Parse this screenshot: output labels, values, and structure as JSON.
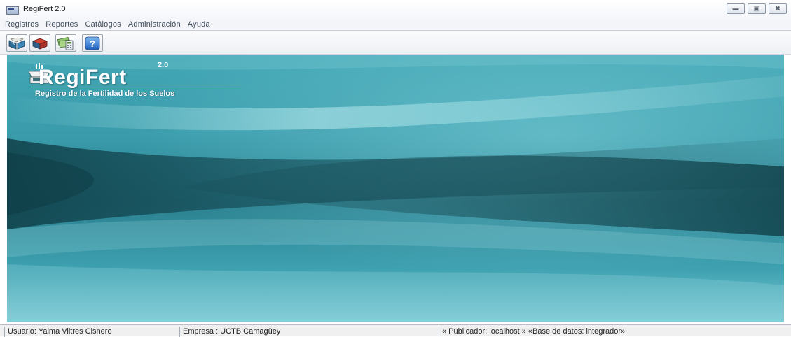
{
  "window": {
    "title": "RegiFert 2.0",
    "controls": [
      "minimize-icon",
      "maximize-icon",
      "close-icon"
    ]
  },
  "menu": {
    "items": [
      {
        "label": "Registros"
      },
      {
        "label": "Reportes"
      },
      {
        "label": "Catálogos"
      },
      {
        "label": "Administración"
      },
      {
        "label": "Ayuda"
      }
    ]
  },
  "toolbar": {
    "buttons": [
      {
        "icon": "open-book-icon"
      },
      {
        "icon": "red-book-icon"
      },
      {
        "icon": "money-calculator-icon"
      },
      {
        "icon": "help-icon"
      }
    ]
  },
  "banner": {
    "app_name": "RegiFert",
    "version": "2.0",
    "subtitle": "Registro de la Fertilidad de los Suelos",
    "logo_icon": "scale-icon"
  },
  "statusbar": {
    "user": "Usuario: Yaima Viltres Cisnero",
    "company": "Empresa : UCTB Camagüey",
    "connection": "« Publicador: localhost » «Base de datos: integrador»"
  },
  "colors": {
    "background_teal": "#3a9cab",
    "dark_teal": "#17505c",
    "help_blue": "#2f7bd6"
  }
}
